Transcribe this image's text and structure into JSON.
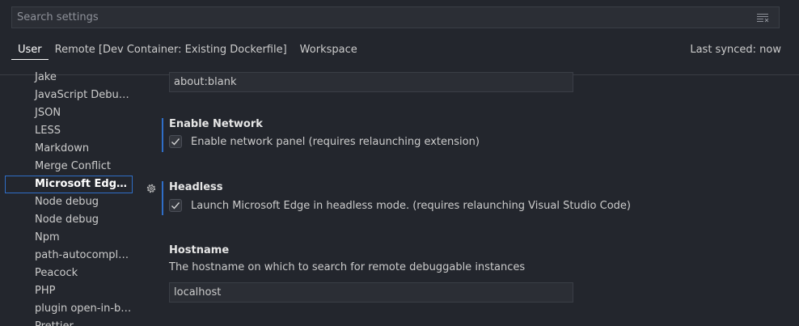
{
  "search": {
    "placeholder": "Search settings"
  },
  "tabs": [
    {
      "label": "User"
    },
    {
      "label": "Remote [Dev Container: Existing Dockerfile]"
    },
    {
      "label": "Workspace"
    }
  ],
  "sync_status": "Last synced: now",
  "toc": {
    "items": [
      {
        "label": "Jake"
      },
      {
        "label": "JavaScript Debugger"
      },
      {
        "label": "JSON"
      },
      {
        "label": "LESS"
      },
      {
        "label": "Markdown"
      },
      {
        "label": "Merge Conflict"
      },
      {
        "label": "Microsoft Edge Tools"
      },
      {
        "label": "Node debug"
      },
      {
        "label": "Node debug"
      },
      {
        "label": "Npm"
      },
      {
        "label": "path-autocomplete"
      },
      {
        "label": "Peacock"
      },
      {
        "label": "PHP"
      },
      {
        "label": "plugin open-in-browser"
      },
      {
        "label": "Prettier"
      }
    ],
    "active_index": 6
  },
  "settings": {
    "url_value": "about:blank",
    "network": {
      "title": "Enable Network",
      "checkbox_label": "Enable network panel (requires relaunching extension)",
      "checked": true
    },
    "headless": {
      "title": "Headless",
      "checkbox_label": "Launch Microsoft Edge in headless mode. (requires relaunching Visual Studio Code)",
      "checked": true
    },
    "hostname": {
      "title": "Hostname",
      "description": "The hostname on which to search for remote debuggable instances",
      "value": "localhost"
    }
  },
  "icons": {
    "filter": "filter-icon",
    "gear": "gear-icon",
    "check": "check-icon"
  },
  "colors": {
    "background": "#23262d",
    "accent": "#2f6ec7",
    "input_bg": "#2b2e35",
    "text": "#cccccc"
  }
}
